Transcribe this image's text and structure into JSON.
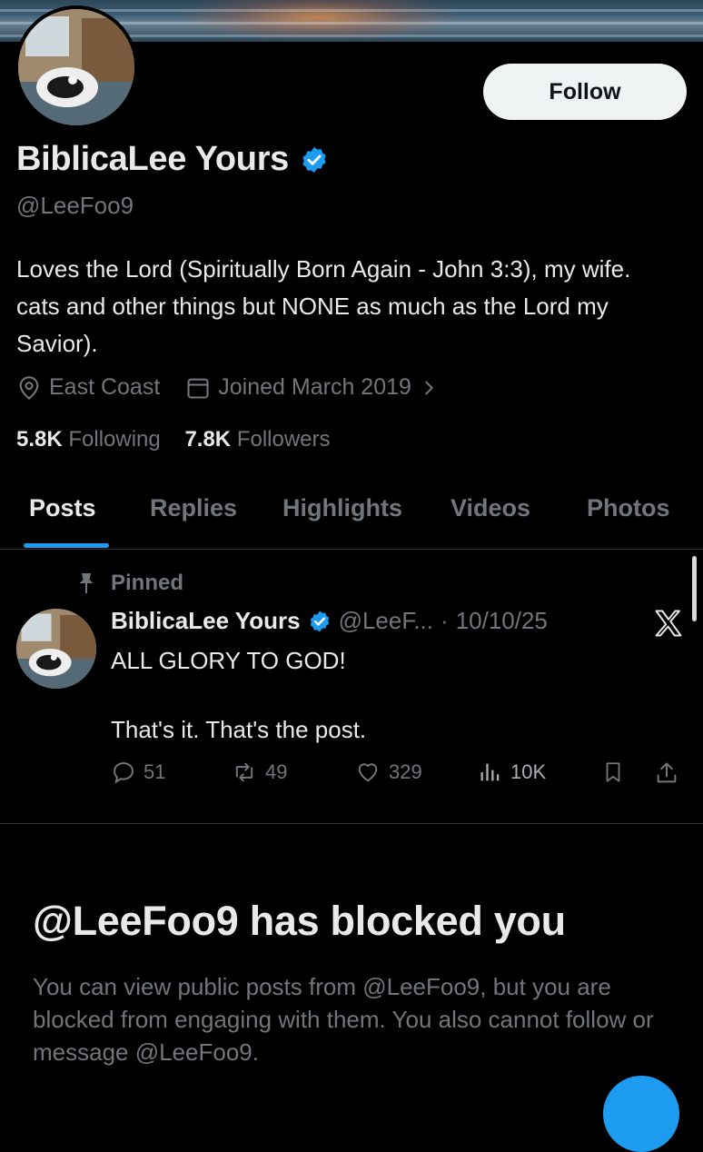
{
  "profile": {
    "display_name": "BiblicaLee Yours",
    "handle": "@LeeFoo9",
    "verified_icon": "verified-badge-icon",
    "bio": "Loves the Lord (Spiritually Born Again - John 3:3), my wife. cats and other things but NONE as much as the Lord my Savior).",
    "location": "East Coast",
    "joined": "Joined March 2019",
    "following_count": "5.8K",
    "following_label": "Following",
    "followers_count": "7.8K",
    "followers_label": "Followers",
    "follow_label": "Follow"
  },
  "tabs": [
    {
      "label": "Posts",
      "active": true
    },
    {
      "label": "Replies",
      "active": false
    },
    {
      "label": "Highlights",
      "active": false
    },
    {
      "label": "Videos",
      "active": false
    },
    {
      "label": "Photos",
      "active": false
    }
  ],
  "pinned_post": {
    "pinned_label": "Pinned",
    "author": "BiblicaLee Yours",
    "handle_truncated": "@LeeF...",
    "separator": "·",
    "date": "10/10/25",
    "text": "ALL GLORY TO GOD!\n\nThat's it. That's the post.",
    "replies": "51",
    "reposts": "49",
    "likes": "329",
    "views": "10K"
  },
  "blocked": {
    "title": "@LeeFoo9 has blocked you",
    "body": "You can view public posts from @LeeFoo9, but you are blocked from engaging with them. You also cannot follow or message @LeeFoo9."
  },
  "colors": {
    "background": "#000000",
    "text": "#e7e9ea",
    "muted": "#71767b",
    "accent": "#1d9bf0",
    "divider": "#2f3336"
  }
}
